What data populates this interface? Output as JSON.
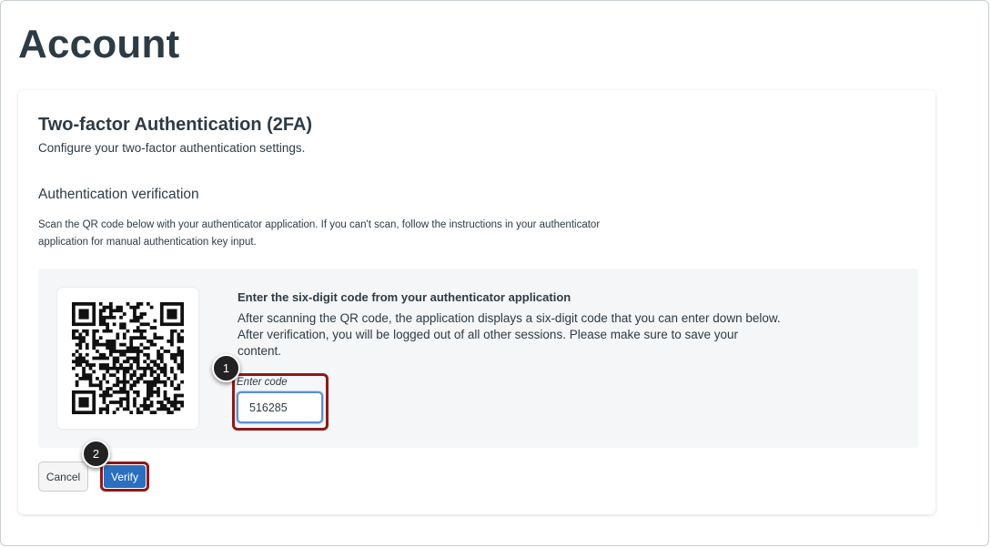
{
  "page": {
    "title": "Account"
  },
  "twofa": {
    "title": "Two-factor Authentication (2FA)",
    "subtitle": "Configure your two-factor authentication settings.",
    "section_title": "Authentication verification",
    "instructions": "Scan the QR code below with your authenticator application. If you can't scan, follow the instructions in your authenticator application for manual authentication key input.",
    "code_title": "Enter the six-digit code from your authenticator application",
    "code_description": "After scanning the QR code, the application displays a six-digit code that you can enter down below. After verification, you will be logged out of all other sessions. Please make sure to save your content.",
    "input_label": "Enter code",
    "input_value": "516285"
  },
  "buttons": {
    "cancel": "Cancel",
    "verify": "Verify"
  },
  "annotations": {
    "step1": "1",
    "step2": "2"
  },
  "colors": {
    "primary": "#2b6fc0",
    "highlight": "#8b1a1a",
    "text": "#2d3b45"
  },
  "icons": {
    "qr": "qr-code-icon"
  }
}
